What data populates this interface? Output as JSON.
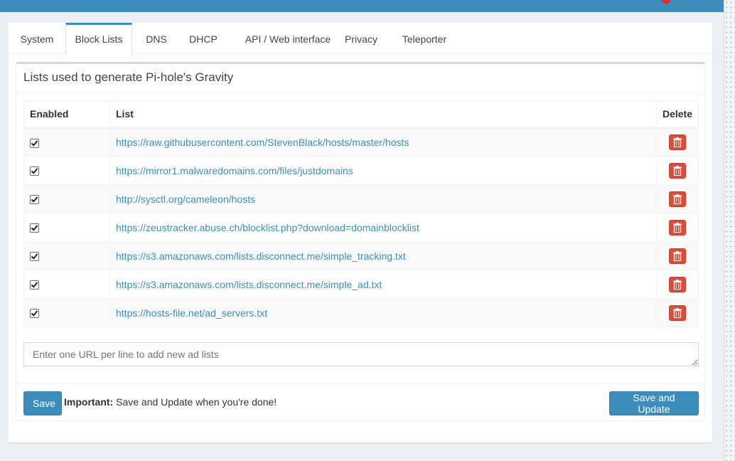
{
  "tabs": [
    {
      "label": "System"
    },
    {
      "label": "Block Lists"
    },
    {
      "label": "DNS"
    },
    {
      "label": "DHCP"
    },
    {
      "label": "API / Web interface"
    },
    {
      "label": "Privacy"
    },
    {
      "label": "Teleporter"
    }
  ],
  "active_tab": "Block Lists",
  "box": {
    "title": "Lists used to generate Pi-hole's Gravity"
  },
  "table": {
    "headers": {
      "enabled": "Enabled",
      "list": "List",
      "delete": "Delete"
    },
    "rows": [
      {
        "enabled": true,
        "url": "https://raw.githubusercontent.com/StevenBlack/hosts/master/hosts"
      },
      {
        "enabled": true,
        "url": "https://mirror1.malwaredomains.com/files/justdomains"
      },
      {
        "enabled": true,
        "url": "http://sysctl.org/cameleon/hosts"
      },
      {
        "enabled": true,
        "url": "https://zeustracker.abuse.ch/blocklist.php?download=domainblocklist"
      },
      {
        "enabled": true,
        "url": "https://s3.amazonaws.com/lists.disconnect.me/simple_tracking.txt"
      },
      {
        "enabled": true,
        "url": "https://s3.amazonaws.com/lists.disconnect.me/simple_ad.txt"
      },
      {
        "enabled": true,
        "url": "https://hosts-file.net/ad_servers.txt"
      }
    ],
    "delete_icon": "trash-icon"
  },
  "new_lists": {
    "placeholder": "Enter one URL per line to add new ad lists",
    "value": ""
  },
  "footer": {
    "save_label": "Save",
    "important_label": "Important:",
    "important_text": "Save and Update when you're done!",
    "save_update_label": "Save and Update"
  },
  "colors": {
    "header_bar": "#3c8dbc",
    "link": "#3c8dbc",
    "primary_button": "#3c8dbc",
    "danger_button": "#dd4b39",
    "page_background": "#ecf0f5"
  }
}
